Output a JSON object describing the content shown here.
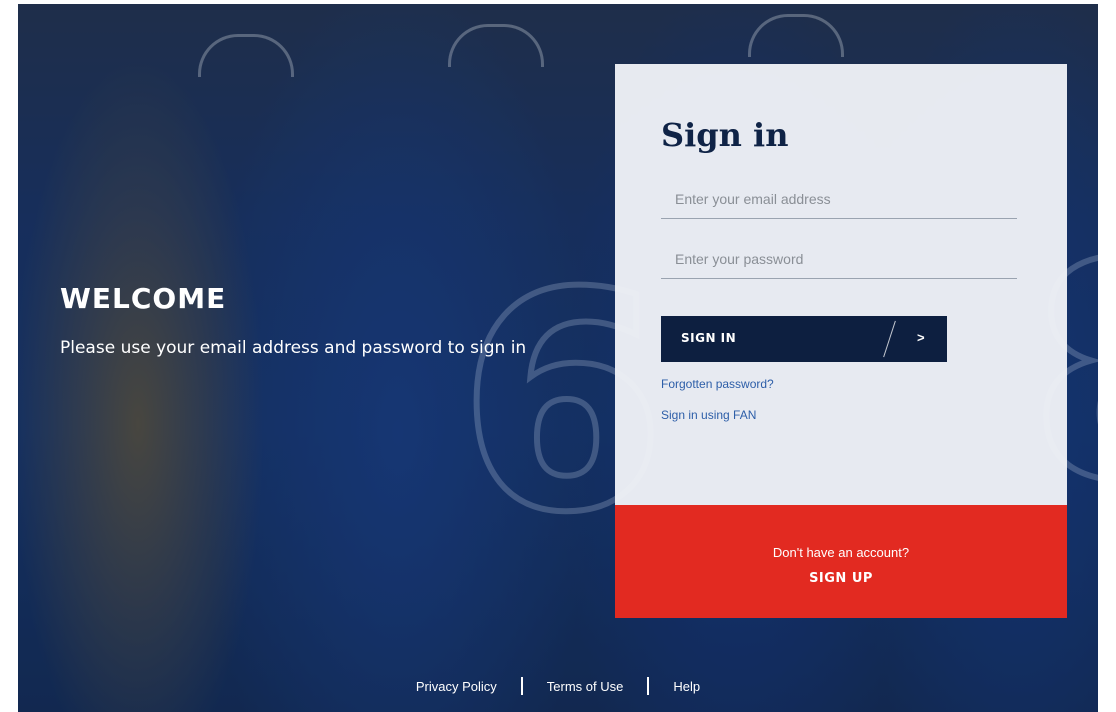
{
  "hero": {
    "title": "WELCOME",
    "subtitle": "Please use your email address and password to sign in"
  },
  "login_card": {
    "title": "Sign in",
    "email_placeholder": "Enter your email address",
    "password_placeholder": "Enter your password",
    "submit_label": "SIGN IN",
    "submit_arrow": ">",
    "forgot_password_label": "Forgotten password?",
    "fan_signin_label": "Sign in using FAN"
  },
  "signup_panel": {
    "prompt": "Don't have an account?",
    "action_label": "SIGN UP"
  },
  "footer": {
    "links": [
      "Privacy Policy",
      "Terms of Use",
      "Help"
    ]
  },
  "colors": {
    "navy": "#0d1f40",
    "signup_red": "#e22a21",
    "link_blue": "#2d5ea8",
    "card_bg": "#eef1f6"
  }
}
